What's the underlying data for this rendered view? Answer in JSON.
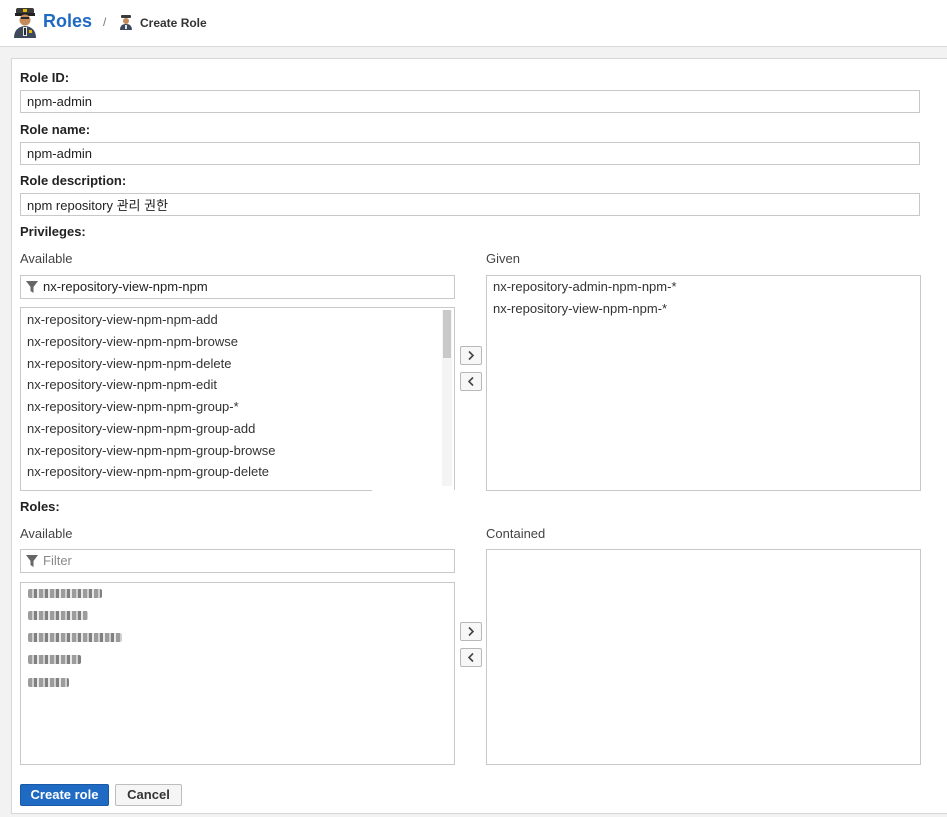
{
  "header": {
    "title": "Roles",
    "separator": "/",
    "breadcrumb_current": "Create Role",
    "logo_icon": "police-officer-icon",
    "breadcrumb_icon": "police-officer-icon"
  },
  "form": {
    "role_id": {
      "label": "Role ID:",
      "value": "npm-admin"
    },
    "role_name": {
      "label": "Role name:",
      "value": "npm-admin"
    },
    "role_description": {
      "label": "Role description:",
      "value": "npm repository 관리 권한"
    }
  },
  "privileges": {
    "label": "Privileges:",
    "available_label": "Available",
    "given_label": "Given",
    "filter_value": "nx-repository-view-npm-npm",
    "available_items": [
      "nx-repository-view-npm-npm-add",
      "nx-repository-view-npm-npm-browse",
      "nx-repository-view-npm-npm-delete",
      "nx-repository-view-npm-npm-edit",
      "nx-repository-view-npm-npm-group-*",
      "nx-repository-view-npm-npm-group-add",
      "nx-repository-view-npm-npm-group-browse",
      "nx-repository-view-npm-npm-group-delete"
    ],
    "given_items": [
      "nx-repository-admin-npm-npm-*",
      "nx-repository-view-npm-npm-*"
    ]
  },
  "roles": {
    "label": "Roles:",
    "available_label": "Available",
    "contained_label": "Contained",
    "filter_placeholder": "Filter"
  },
  "buttons": {
    "create": "Create role",
    "cancel": "Cancel"
  },
  "colors": {
    "accent": "#1f6ac2",
    "panel_bg": "#ffffff",
    "page_bg": "#f2f2f2"
  }
}
